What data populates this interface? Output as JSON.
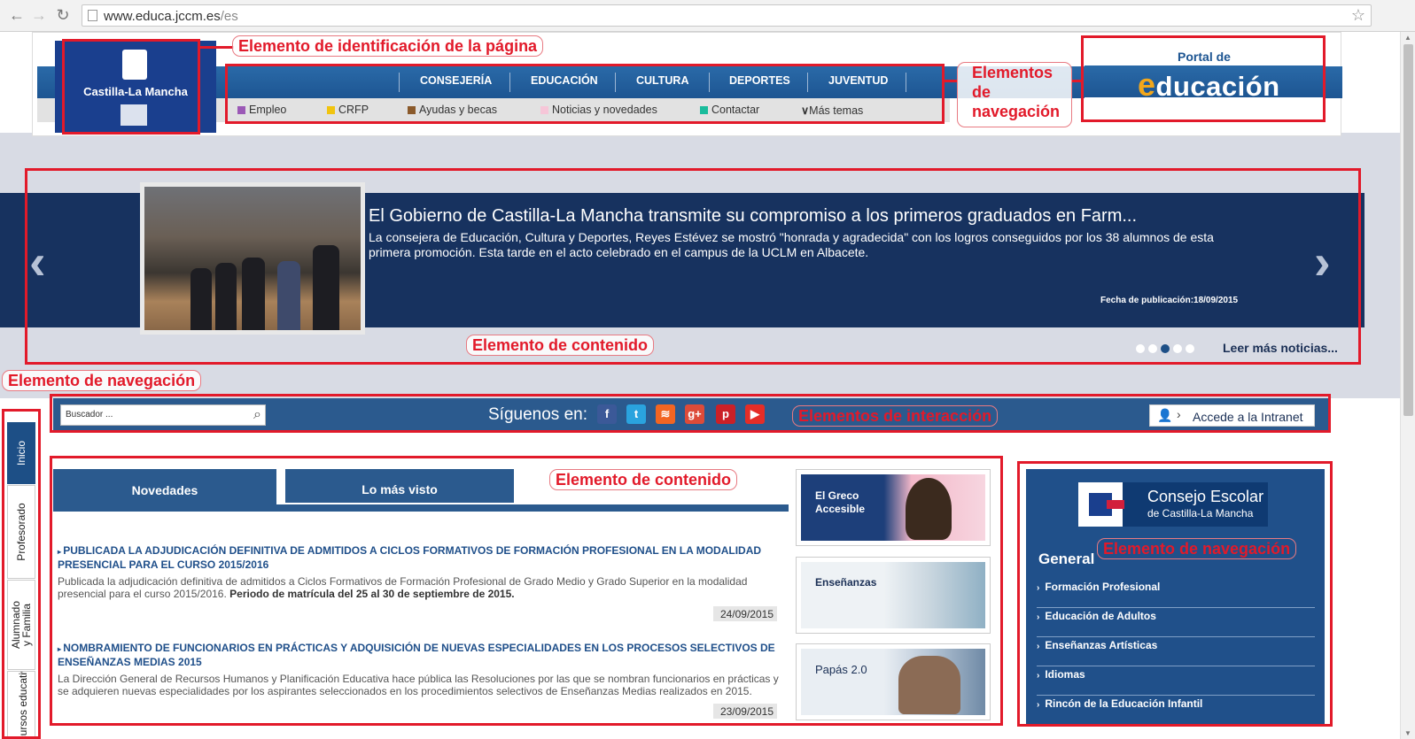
{
  "browser": {
    "url_host": "www.educa.jccm.es",
    "url_path": "/es"
  },
  "header": {
    "logo_text": "Castilla-La Mancha",
    "main_nav": [
      "CONSEJERÍA",
      "EDUCACIÓN",
      "CULTURA",
      "DEPORTES",
      "JUVENTUD"
    ],
    "sub_nav": [
      {
        "label": "Empleo",
        "color": "#9b59b6"
      },
      {
        "label": "CRFP",
        "color": "#f1c40f"
      },
      {
        "label": "Ayudas y becas",
        "color": "#8b5a2b"
      },
      {
        "label": "Noticias y novedades",
        "color": "#f6c6d8"
      },
      {
        "label": "Contactar",
        "color": "#1abc9c"
      }
    ],
    "more_topics": "Más temas",
    "portal_de": "Portal de",
    "portal_e": "e",
    "portal_rest": "ducación"
  },
  "slider": {
    "title": "El Gobierno de Castilla-La Mancha transmite su compromiso a los primeros graduados en Farm...",
    "description": "La consejera de Educación, Cultura y Deportes, Reyes Estévez se mostró \"honrada y agradecida\" con los logros conseguidos por los 38 alumnos de esta primera promoción. Esta tarde en el acto celebrado en el campus de la UCLM en Albacete.",
    "date": "Fecha de publicación:18/09/2015",
    "more_news": "Leer más noticias...",
    "dots": 5,
    "active_dot": 3
  },
  "toolbar": {
    "search_placeholder": "Buscador ...",
    "follow_label": "Síguenos en:",
    "social": [
      {
        "name": "facebook",
        "glyph": "f",
        "color": "#3b5998"
      },
      {
        "name": "twitter",
        "glyph": "t",
        "color": "#2aa3de"
      },
      {
        "name": "rss",
        "glyph": "≋",
        "color": "#f26522"
      },
      {
        "name": "google-plus",
        "glyph": "g+",
        "color": "#dd4b39"
      },
      {
        "name": "pinterest",
        "glyph": "p",
        "color": "#cb2027"
      },
      {
        "name": "youtube",
        "glyph": "▶",
        "color": "#e52d27"
      }
    ],
    "intranet_label": "Accede a la Intranet"
  },
  "left_tabs": [
    "Inicio",
    "Profesorado",
    "Alumnado y Familia",
    "Recursos educativos"
  ],
  "content_tabs": {
    "news_tab": "Novedades",
    "most_viewed_tab": "Lo más visto"
  },
  "news": [
    {
      "title": "PUBLICADA LA ADJUDICACIÓN DEFINITIVA DE ADMITIDOS A CICLOS FORMATIVOS DE FORMACIÓN PROFESIONAL EN LA MODALIDAD PRESENCIAL PARA EL CURSO 2015/2016",
      "body": "Publicada la adjudicación definitiva de admitidos a Ciclos Formativos de Formación Profesional de Grado Medio y Grado Superior en la modalidad presencial para el curso 2015/2016.",
      "body_bold": "Periodo de matrícula del 25 al 30 de septiembre de 2015.",
      "date": "24/09/2015"
    },
    {
      "title": "NOMBRAMIENTO DE FUNCIONARIOS EN PRÁCTICAS Y ADQUISICIÓN DE NUEVAS ESPECIALIDADES EN LOS PROCESOS SELECTIVOS DE ENSEÑANZAS MEDIAS 2015",
      "body": "La Dirección General de Recursos Humanos y Planificación Educativa hace pública las Resoluciones por las que se nombran funcionarios en prácticas y se adquieren nuevas especialidades por los aspirantes seleccionados en los procedimientos selectivos de Enseñanzas Medias realizados en 2015.",
      "body_bold": "",
      "date": "23/09/2015"
    }
  ],
  "promos": [
    {
      "line1": "El Greco",
      "line2": "Accesible"
    },
    {
      "line1": "Enseñanzas",
      "line2": ""
    },
    {
      "line1": "Papás 2.0",
      "line2": ""
    }
  ],
  "right_panel": {
    "consejo_line1": "Consejo Escolar",
    "consejo_line2": "de Castilla-La Mancha",
    "heading": "General",
    "links": [
      "Formación Profesional",
      "Educación de Adultos",
      "Enseñanzas Artísticas",
      "Idiomas",
      "Rincón de la Educación Infantil"
    ]
  },
  "annotations": {
    "id_element": "Elemento de identificación de la página",
    "nav_elements_1": "Elementos",
    "nav_elements_2": "de",
    "nav_elements_3": "navegación",
    "content_element_slider": "Elemento de contenido",
    "nav_element_left": "Elemento de navegación",
    "interaction_elements": "Elementos de interacción",
    "content_element_news": "Elemento de contenido",
    "nav_element_right": "Elemento de navegación"
  },
  "colors": {
    "annotation_red": "#e21a2a",
    "brand_blue": "#1d5592",
    "slider_navy": "#17325f"
  }
}
